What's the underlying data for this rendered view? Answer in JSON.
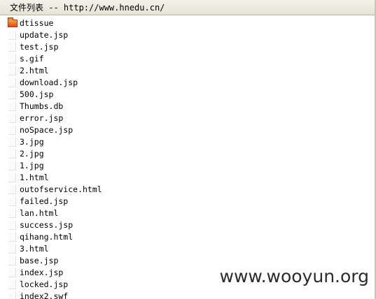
{
  "header": {
    "title": "文件列表 -- http://www.hnedu.cn/"
  },
  "files": [
    {
      "name": "dtissue",
      "type": "folder",
      "icon": "folder-icon"
    },
    {
      "name": "update.jsp",
      "type": "file",
      "icon": "file-icon"
    },
    {
      "name": "test.jsp",
      "type": "file",
      "icon": "file-icon"
    },
    {
      "name": "s.gif",
      "type": "file",
      "icon": "file-icon"
    },
    {
      "name": "2.html",
      "type": "file",
      "icon": "file-icon"
    },
    {
      "name": "download.jsp",
      "type": "file",
      "icon": "file-icon"
    },
    {
      "name": "500.jsp",
      "type": "file",
      "icon": "file-icon"
    },
    {
      "name": "Thumbs.db",
      "type": "file",
      "icon": "file-icon"
    },
    {
      "name": "error.jsp",
      "type": "file",
      "icon": "file-icon"
    },
    {
      "name": "noSpace.jsp",
      "type": "file",
      "icon": "file-icon"
    },
    {
      "name": "3.jpg",
      "type": "file",
      "icon": "file-icon"
    },
    {
      "name": "2.jpg",
      "type": "file",
      "icon": "file-icon"
    },
    {
      "name": "1.jpg",
      "type": "file",
      "icon": "file-icon"
    },
    {
      "name": "1.html",
      "type": "file",
      "icon": "file-icon"
    },
    {
      "name": "outofservice.html",
      "type": "file",
      "icon": "file-icon"
    },
    {
      "name": "failed.jsp",
      "type": "file",
      "icon": "file-icon"
    },
    {
      "name": "lan.html",
      "type": "file",
      "icon": "file-icon"
    },
    {
      "name": "success.jsp",
      "type": "file",
      "icon": "file-icon"
    },
    {
      "name": "qihang.html",
      "type": "file",
      "icon": "file-icon"
    },
    {
      "name": "3.html",
      "type": "file",
      "icon": "file-icon"
    },
    {
      "name": "base.jsp",
      "type": "file",
      "icon": "file-icon"
    },
    {
      "name": "index.jsp",
      "type": "file",
      "icon": "file-icon"
    },
    {
      "name": "locked.jsp",
      "type": "file",
      "icon": "file-icon"
    },
    {
      "name": "index2.swf",
      "type": "file",
      "icon": "file-icon"
    }
  ],
  "watermark": {
    "text": "www.wooyun.org"
  },
  "colors": {
    "folder": "#e8611c",
    "header_bg": "#ece9d8"
  }
}
